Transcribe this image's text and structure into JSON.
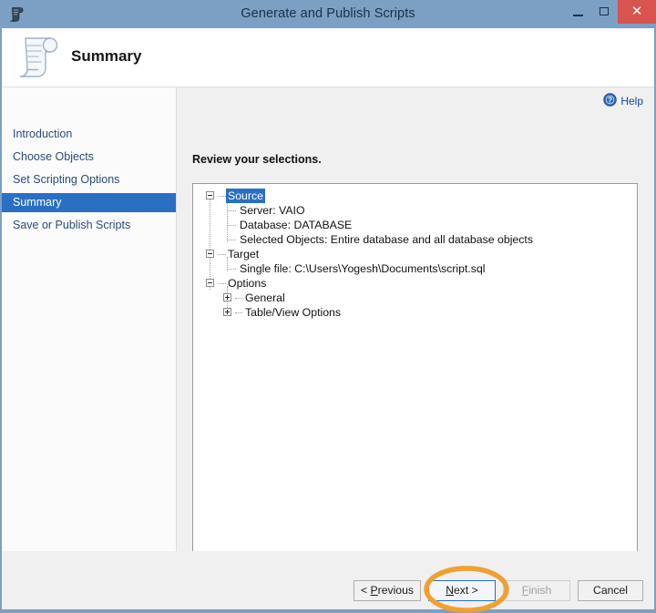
{
  "window": {
    "title": "Generate and Publish Scripts",
    "title_icon": "script-scroll-icon",
    "controls": {
      "minimize": "minimize-icon",
      "maximize": "maximize-icon",
      "close": "✕"
    },
    "colors": {
      "titlebar": "#7ba0c4",
      "close_button": "#d9534f",
      "accent_selection": "#2a6fc2",
      "link": "#16499c",
      "annotation": "#f0a030"
    }
  },
  "header": {
    "title": "Summary",
    "icon": "script-scroll-icon"
  },
  "sidebar": {
    "items": [
      {
        "label": "Introduction",
        "selected": false
      },
      {
        "label": "Choose Objects",
        "selected": false
      },
      {
        "label": "Set Scripting Options",
        "selected": false
      },
      {
        "label": "Summary",
        "selected": true
      },
      {
        "label": "Save or Publish Scripts",
        "selected": false
      }
    ]
  },
  "content": {
    "help_label": "Help",
    "help_icon": "help-circle-icon",
    "heading": "Review your selections.",
    "tree": [
      {
        "label": "Source",
        "expander": "minus",
        "selected": true,
        "children": [
          {
            "label": "Server: VAIO"
          },
          {
            "label": "Database: DATABASE"
          },
          {
            "label": "Selected Objects: Entire database and all database objects"
          }
        ]
      },
      {
        "label": "Target",
        "expander": "minus",
        "selected": false,
        "children": [
          {
            "label": "Single file: C:\\Users\\Yogesh\\Documents\\script.sql"
          }
        ]
      },
      {
        "label": "Options",
        "expander": "minus",
        "selected": false,
        "children": [
          {
            "label": "General",
            "expander": "plus"
          },
          {
            "label": "Table/View Options",
            "expander": "plus"
          }
        ]
      }
    ]
  },
  "footer": {
    "buttons": [
      {
        "id": "previous",
        "label": "< Previous",
        "accel": "P",
        "state": "enabled"
      },
      {
        "id": "next",
        "label": "Next >",
        "accel": "N",
        "state": "focused"
      },
      {
        "id": "finish",
        "label": "Finish",
        "accel": "F",
        "state": "disabled"
      },
      {
        "id": "cancel",
        "label": "Cancel",
        "accel": "",
        "state": "enabled"
      }
    ]
  },
  "annotation": {
    "shape": "ellipse",
    "target": "next-button",
    "color": "#f0a030"
  }
}
